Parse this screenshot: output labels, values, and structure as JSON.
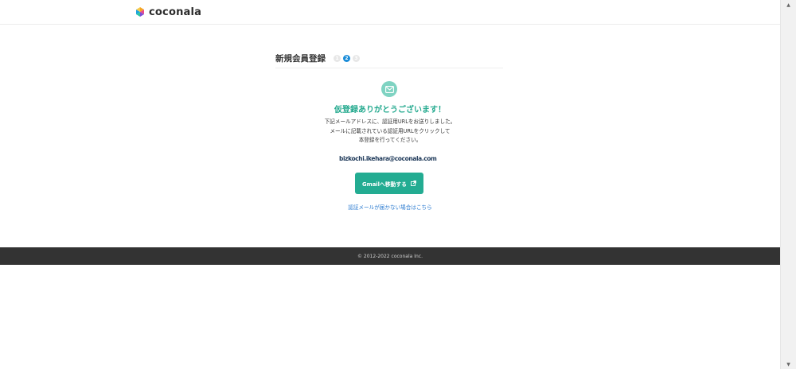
{
  "header": {
    "logo_text": "coconala",
    "logo_icon": "coconala-logo-icon"
  },
  "signup": {
    "title": "新規会員登録",
    "steps": [
      "1",
      "2",
      "3"
    ],
    "active_step": 2,
    "mail_icon": "envelope-icon",
    "headline": "仮登録ありがとうございます！",
    "desc_line1": "下記メールアドレスに、認証用URLをお送りしました。",
    "desc_line2": "メールに記載されている認証用URLをクリックして",
    "desc_line3": "本登録を行ってください。",
    "email": "bizkochi.ikehara@coconala.com",
    "gmail_button": "Gmailへ移動する",
    "external_icon": "external-link-icon",
    "help_link": "認証メールが届かない場合はこちら"
  },
  "footer": {
    "copyright": "© 2012-2022 coconala Inc."
  },
  "colors": {
    "accent": "#23ac92",
    "headline": "#23a98e",
    "step_active": "#1a8cd8",
    "footer_bg": "#333333",
    "link": "#2b7bd0"
  }
}
